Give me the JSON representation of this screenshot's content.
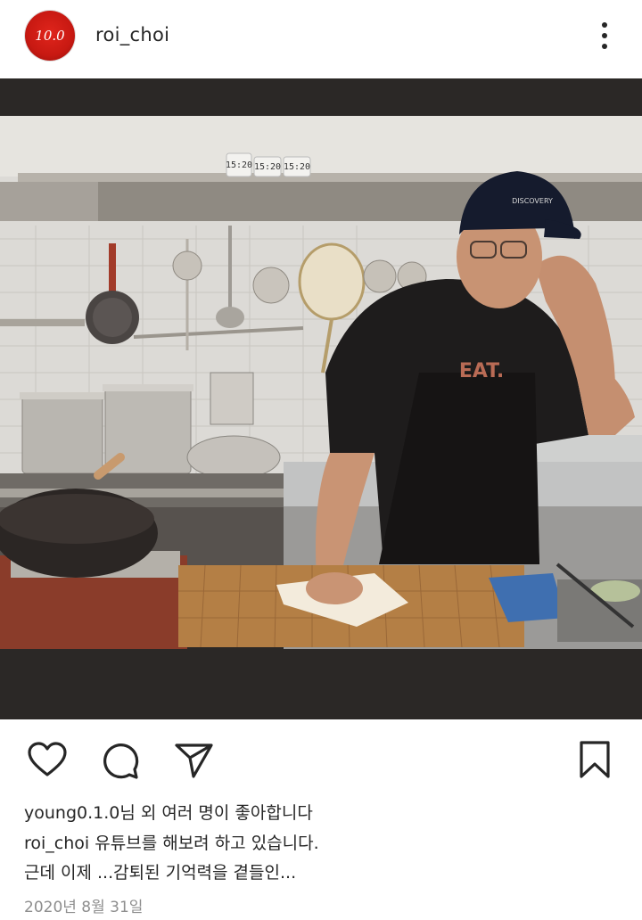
{
  "post": {
    "username": "roi_choi",
    "avatar_text": "10.0",
    "likes_text": "young0.1.0님 외 여러 명이 좋아합니다",
    "caption": {
      "username": "roi_choi",
      "line1_text": "유튜브를 해보려 하고 있습니다.",
      "line2_text": "근데 이제 ...감퇴된 기억력을 곁들인..."
    },
    "date": "2020년 8월 31일"
  },
  "photo": {
    "apron_text": "EAT.",
    "cap_logo_text": "DISCOVERY",
    "timer_texts": [
      "15:20",
      "15:20",
      "15:20"
    ]
  },
  "icons": {
    "more": "more-vertical-icon",
    "like": "heart-icon",
    "comment": "comment-icon",
    "share": "send-icon",
    "save": "bookmark-icon"
  }
}
